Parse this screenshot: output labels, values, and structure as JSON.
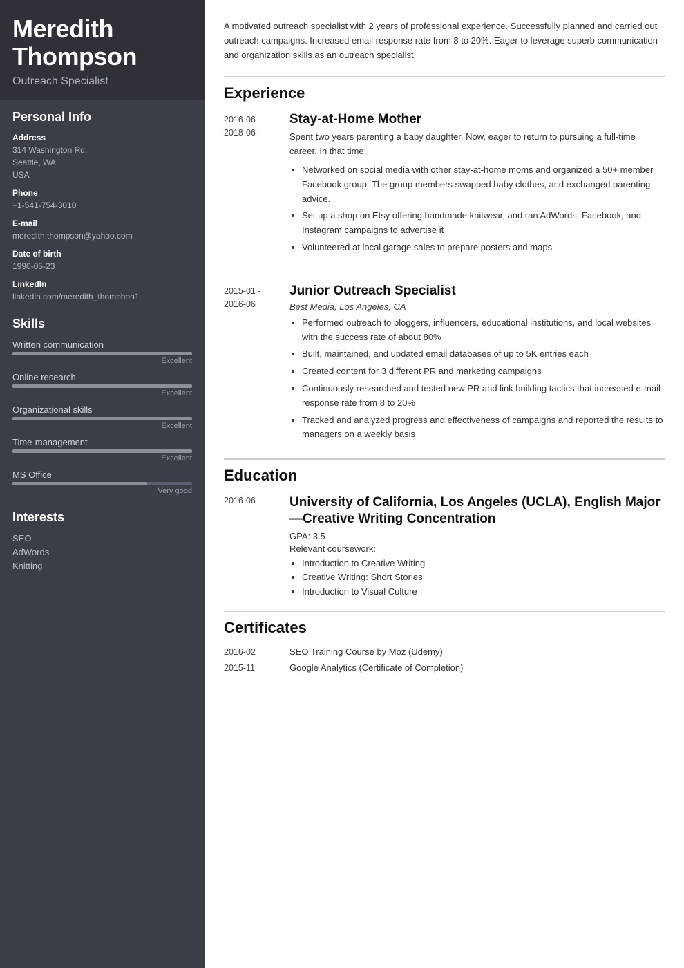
{
  "sidebar": {
    "name": "Meredith\nThompson",
    "name_line1": "Meredith",
    "name_line2": "Thompson",
    "title": "Outreach Specialist",
    "personal_info": {
      "section_title": "Personal Info",
      "address_label": "Address",
      "address_line1": "314 Washington Rd.",
      "address_line2": "Seattle, WA",
      "address_line3": "USA",
      "phone_label": "Phone",
      "phone": "+1-541-754-3010",
      "email_label": "E-mail",
      "email": "meredith.thompson@yahoo.com",
      "dob_label": "Date of birth",
      "dob": "1990-05-23",
      "linkedin_label": "LinkedIn",
      "linkedin": "linkedin.com/meredith_thomphon1"
    },
    "skills": {
      "section_title": "Skills",
      "items": [
        {
          "name": "Written communication",
          "level": "Excellent",
          "pct": 100
        },
        {
          "name": "Online research",
          "level": "Excellent",
          "pct": 100
        },
        {
          "name": "Organizational skills",
          "level": "Excellent",
          "pct": 100
        },
        {
          "name": "Time-management",
          "level": "Excellent",
          "pct": 100
        },
        {
          "name": "MS Office",
          "level": "Very good",
          "pct": 75
        }
      ]
    },
    "interests": {
      "section_title": "Interests",
      "items": [
        "SEO",
        "AdWords",
        "Knitting"
      ]
    }
  },
  "main": {
    "summary": "A motivated outreach specialist with 2 years of professional experience. Successfully planned and carried out outreach campaigns. Increased email response rate from 8 to 20%. Eager to leverage superb communication and organization skills as an outreach specialist.",
    "experience": {
      "section_title": "Experience",
      "items": [
        {
          "date_start": "2016-06 -",
          "date_end": "2018-06",
          "title": "Stay-at-Home Mother",
          "company": null,
          "description": "Spent two years parenting a baby daughter. Now, eager to return to pursuing a full-time career. In that time:",
          "bullets": [
            "Networked on social media with other stay-at-home moms and organized a 50+ member Facebook group. The group members swapped baby clothes, and exchanged parenting advice.",
            "Set up a shop on Etsy offering handmade knitwear, and ran AdWords, Facebook, and Instagram campaigns to advertise it",
            "Volunteered at local garage sales to prepare posters and maps"
          ]
        },
        {
          "date_start": "2015-01 -",
          "date_end": "2016-06",
          "title": "Junior Outreach Specialist",
          "company": "Best Media, Los Angeles, CA",
          "description": null,
          "bullets": [
            "Performed outreach to bloggers, influencers, educational institutions, and local websites with the success rate of about 80%",
            "Built, maintained, and updated email databases of up to 5K entries each",
            "Created content for 3 different PR and marketing campaigns",
            "Continuously researched and tested new PR and link building tactics that increased e-mail response rate from 8 to 20%",
            "Tracked and analyzed progress and effectiveness of campaigns and reported the results to managers on a weekly basis"
          ]
        }
      ]
    },
    "education": {
      "section_title": "Education",
      "items": [
        {
          "date": "2016-06",
          "school": "University of California, Los Angeles (UCLA), English Major—Creative Writing Concentration",
          "gpa": "GPA: 3.5",
          "coursework_label": "Relevant coursework:",
          "bullets": [
            "Introduction to Creative Writing",
            "Creative Writing: Short Stories",
            "Introduction to Visual Culture"
          ]
        }
      ]
    },
    "certificates": {
      "section_title": "Certificates",
      "items": [
        {
          "date": "2016-02",
          "name": "SEO Training Course by Moz (Udemy)"
        },
        {
          "date": "2015-11",
          "name": "Google Analytics (Certificate of Completion)"
        }
      ]
    }
  }
}
